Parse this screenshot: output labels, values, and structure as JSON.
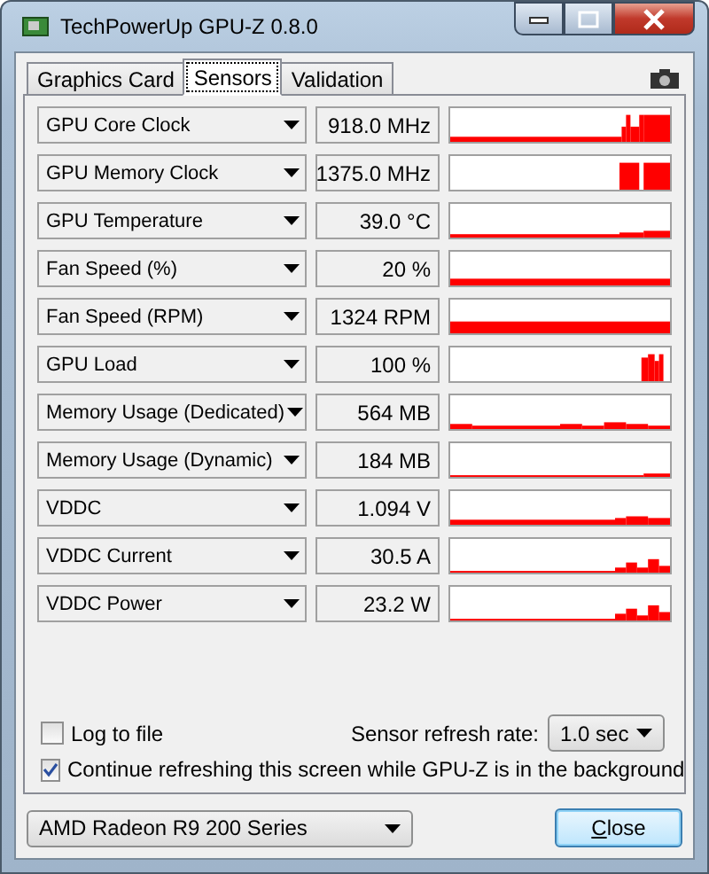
{
  "window": {
    "title": "TechPowerUp GPU-Z 0.8.0"
  },
  "tabs": [
    {
      "label": "Graphics Card",
      "selected": false
    },
    {
      "label": "Sensors",
      "selected": true
    },
    {
      "label": "Validation",
      "selected": false
    }
  ],
  "sensors": [
    {
      "name": "GPU Core Clock",
      "value": "918.0 MHz"
    },
    {
      "name": "GPU Memory Clock",
      "value": "1375.0 MHz"
    },
    {
      "name": "GPU Temperature",
      "value": "39.0 °C"
    },
    {
      "name": "Fan Speed (%)",
      "value": "20 %"
    },
    {
      "name": "Fan Speed (RPM)",
      "value": "1324 RPM"
    },
    {
      "name": "GPU Load",
      "value": "100 %"
    },
    {
      "name": "Memory Usage (Dedicated)",
      "value": "564 MB"
    },
    {
      "name": "Memory Usage (Dynamic)",
      "value": "184 MB"
    },
    {
      "name": "VDDC",
      "value": "1.094 V"
    },
    {
      "name": "VDDC Current",
      "value": "30.5 A"
    },
    {
      "name": "VDDC Power",
      "value": "23.2 W"
    }
  ],
  "log_to_file": {
    "label": "Log to file",
    "checked": false
  },
  "refresh_rate": {
    "label": "Sensor refresh rate:",
    "value": "1.0 sec"
  },
  "continue_refreshing": {
    "label": "Continue refreshing this screen while GPU-Z is in the background",
    "checked": true
  },
  "gpu_select": {
    "value": "AMD Radeon R9 200 Series"
  },
  "close_button": {
    "label": "Close"
  }
}
